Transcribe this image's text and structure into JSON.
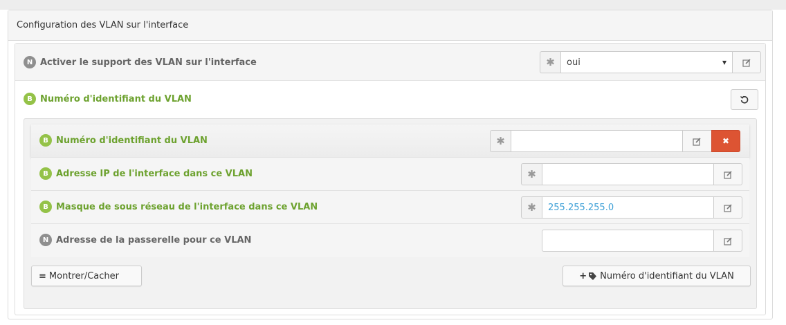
{
  "panel": {
    "title": "Configuration des VLAN sur l'interface"
  },
  "vlan_support": {
    "badge": "N",
    "label": "Activer le support des VLAN sur l'interface",
    "select_value": "oui",
    "required_mark": "✱",
    "caret": "▾",
    "edit_icon": "edit-icon"
  },
  "vlan_id_group": {
    "badge": "B",
    "label": "Numéro d'identifiant du VLAN",
    "reset_icon": "refresh-icon"
  },
  "sub_fields": [
    {
      "badge": "B",
      "label": "Numéro d'identifiant du VLAN",
      "value": "",
      "required_mark": "✱",
      "delete_icon": "✖"
    },
    {
      "badge": "B",
      "label": "Adresse IP de l'interface dans ce VLAN",
      "value": "",
      "required_mark": "✱"
    },
    {
      "badge": "B",
      "label": "Masque de sous réseau de l'interface dans ce VLAN",
      "value": "255.255.255.0",
      "required_mark": "✱"
    },
    {
      "badge": "N",
      "label": "Adresse de la passerelle pour ce VLAN",
      "value": ""
    }
  ],
  "buttons": {
    "toggle": "Montrer/Cacher",
    "toggle_icon": "≡",
    "add": "Numéro d'identifiant du VLAN",
    "add_icon": "+"
  },
  "colors": {
    "mandatory_green": "#6da22f",
    "delete_red": "#dd5433",
    "value_blue": "#3c9fd6"
  }
}
